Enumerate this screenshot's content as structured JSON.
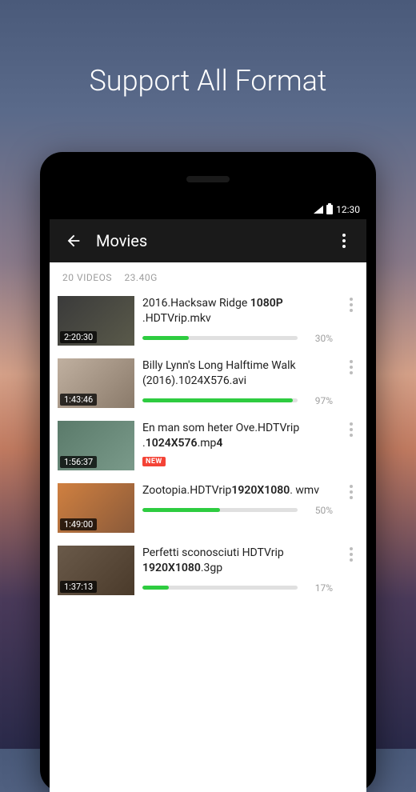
{
  "headline": "Support All Format",
  "statusbar": {
    "time": "12:30"
  },
  "appbar": {
    "title": "Movies"
  },
  "summary": {
    "count": "20 VIDEOS",
    "size": "23.40G"
  },
  "badges": {
    "new": "NEW"
  },
  "items": [
    {
      "title_html": "2016.Hacksaw Ridge <b>1080P</b> .HDTVrip.mkv",
      "duration": "2:20:30",
      "progress": 30,
      "progress_label": "30%",
      "new": false
    },
    {
      "title_html": "Billy Lynn's Long Halftime Walk (2016).1024X576.avi",
      "duration": "1:43:46",
      "progress": 97,
      "progress_label": "97%",
      "new": false
    },
    {
      "title_html": "En man som heter Ove.HDTVrip .<b>1024X576</b>.mp<b>4</b>",
      "duration": "1:56:37",
      "progress": null,
      "progress_label": "",
      "new": true
    },
    {
      "title_html": "Zootopia.HDTVrip<b>1920X1080</b>. wmv",
      "duration": "1:49:00",
      "progress": 50,
      "progress_label": "50%",
      "new": false
    },
    {
      "title_html": " Perfetti sconosciuti HDTVrip <b>1920X1080</b>.3gp",
      "duration": "1:37:13",
      "progress": 17,
      "progress_label": "17%",
      "new": false
    }
  ]
}
